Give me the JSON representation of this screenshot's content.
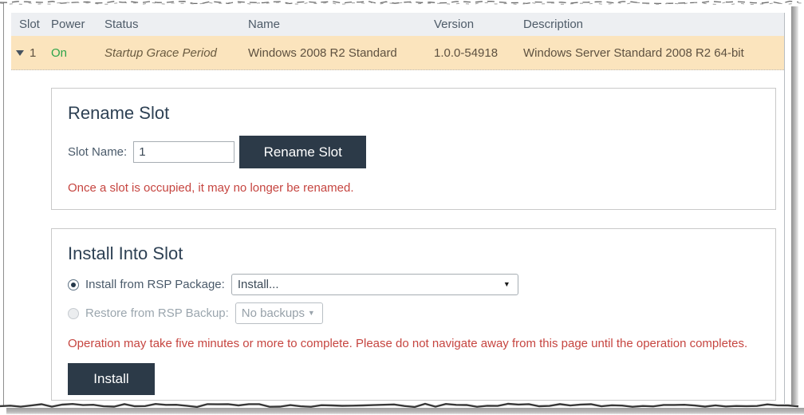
{
  "table": {
    "columns": [
      "Slot",
      "Power",
      "Status",
      "Name",
      "Version",
      "Description"
    ],
    "row": {
      "slot": "1",
      "power": "On",
      "status": "Startup Grace Period",
      "name": "Windows 2008 R2 Standard",
      "version": "1.0.0-54918",
      "description": "Windows Server Standard 2008 R2 64-bit"
    }
  },
  "rename_panel": {
    "title": "Rename Slot",
    "slot_name_label": "Slot Name:",
    "slot_name_value": "1",
    "button_label": "Rename Slot",
    "warning": "Once a slot is occupied, it may no longer be renamed."
  },
  "install_panel": {
    "title": "Install Into Slot",
    "package_radio_label": "Install from RSP Package:",
    "package_select_value": "Install...",
    "backup_radio_label": "Restore from RSP Backup:",
    "backup_select_value": "No backups",
    "warning": "Operation may take five minutes or more to complete. Please do not navigate away from this page until the operation completes.",
    "button_label": "Install"
  },
  "icons": {
    "row_expander": "triangle-down",
    "select_caret": "▼"
  },
  "colors": {
    "row_highlight": "#fbe4bd",
    "header_bg": "#edeff2",
    "power_on_green": "#2da44a",
    "warning_red": "#c64540",
    "button_bg": "#2c3a48",
    "heading_text": "#2e4154"
  }
}
